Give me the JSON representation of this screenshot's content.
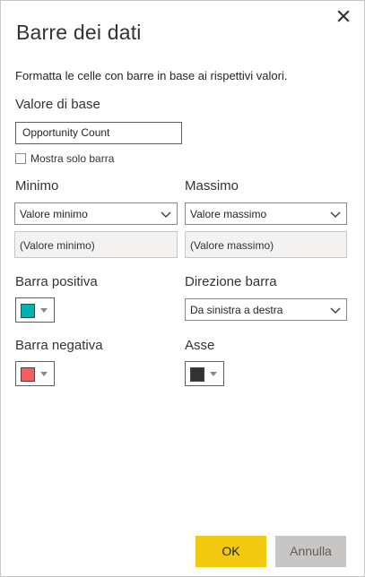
{
  "dialog": {
    "title": "Barre dei dati",
    "description": "Formatta le celle con barre in base ai rispettivi valori."
  },
  "base_value": {
    "label": "Valore di base",
    "value": "Opportunity Count",
    "show_bar_only_label": "Mostra solo barra",
    "show_bar_only_checked": false
  },
  "minimum": {
    "label": "Minimo",
    "selected": "Valore minimo",
    "value_placeholder": "(Valore minimo)"
  },
  "maximum": {
    "label": "Massimo",
    "selected": "Valore massimo",
    "value_placeholder": "(Valore massimo)"
  },
  "positive_bar": {
    "label": "Barra positiva",
    "color": "#00b3b3"
  },
  "bar_direction": {
    "label": "Direzione barra",
    "selected": "Da sinistra a destra"
  },
  "negative_bar": {
    "label": "Barra negativa",
    "color": "#f45e5e"
  },
  "axis": {
    "label": "Asse",
    "color": "#333333"
  },
  "buttons": {
    "ok": "OK",
    "cancel": "Annulla"
  },
  "icons": {
    "close": "close-icon",
    "dropdown": "chevron-down-icon",
    "color_caret": "caret-down-icon"
  }
}
